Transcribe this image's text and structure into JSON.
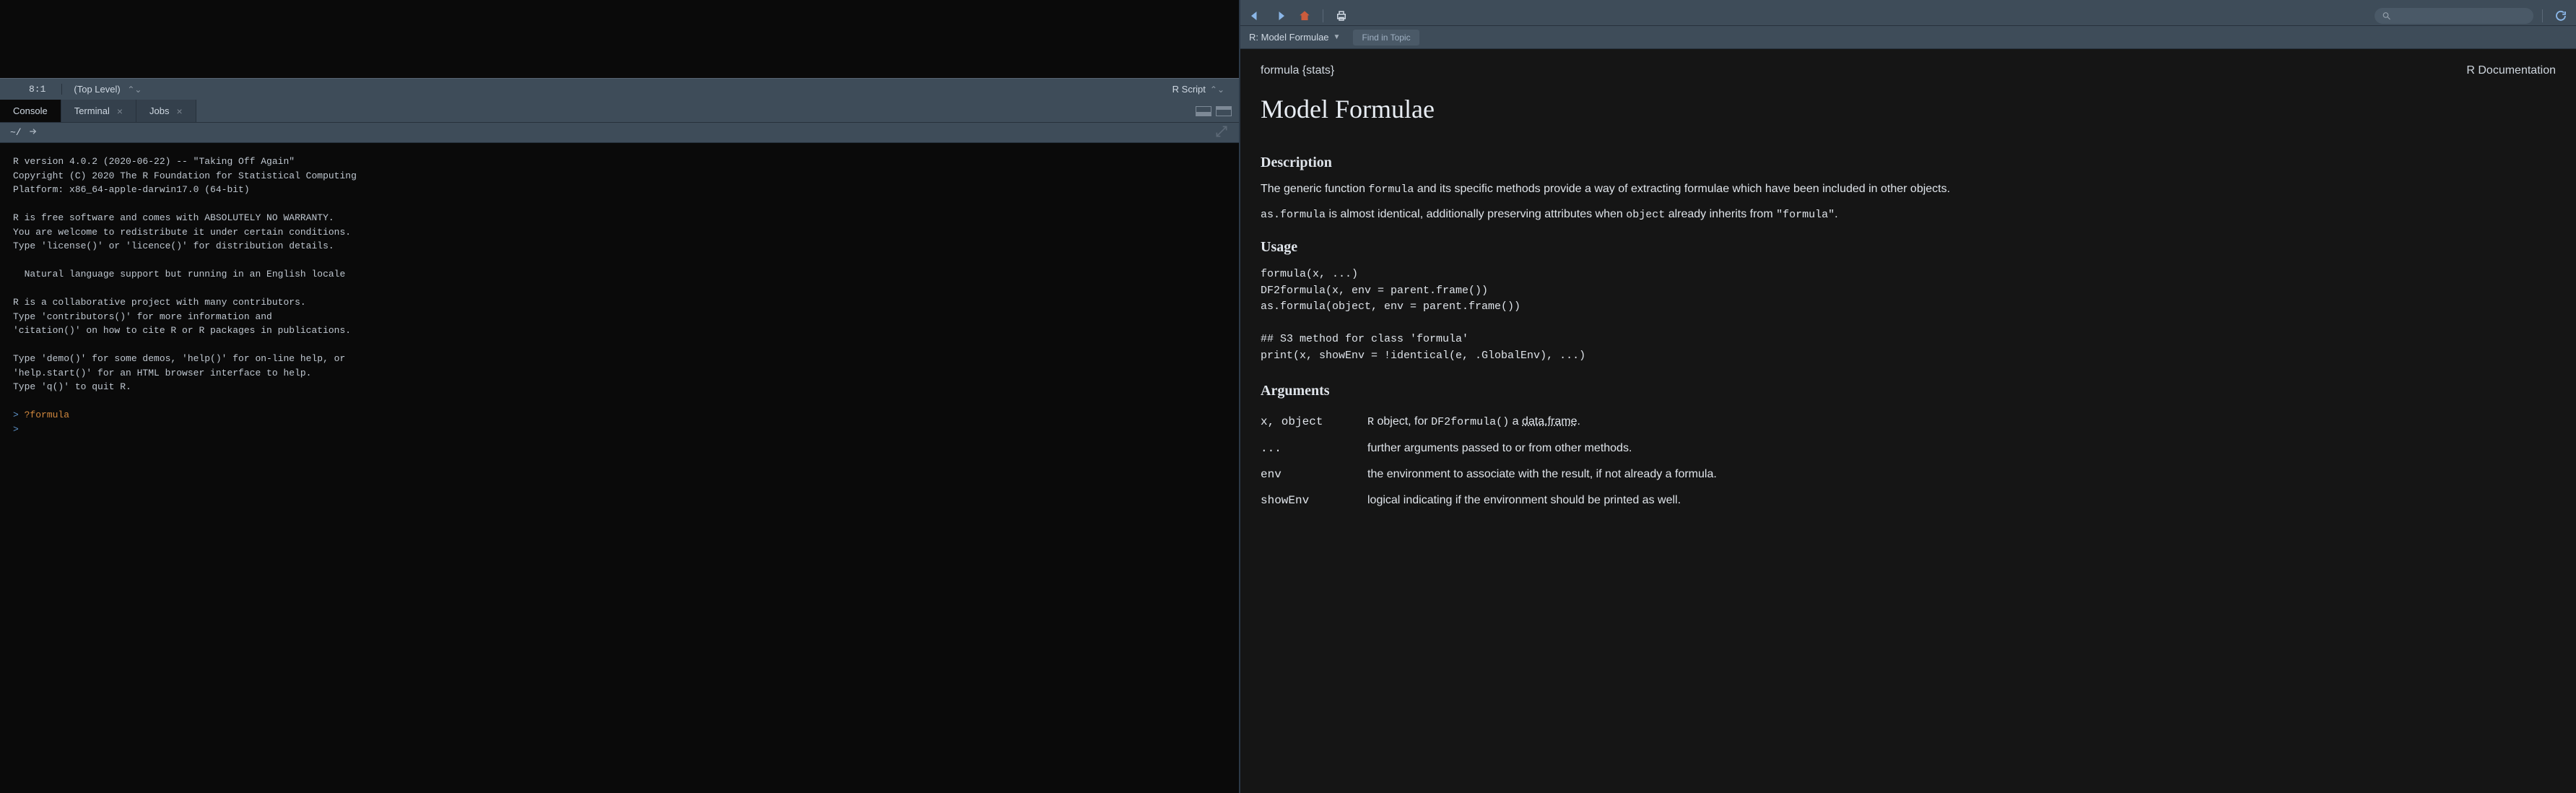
{
  "editor": {
    "cursor_pos": "8:1",
    "scope": "(Top Level)",
    "filetype": "R Script"
  },
  "console_tabs": [
    {
      "label": "Console",
      "closable": false,
      "selected": true
    },
    {
      "label": "Terminal",
      "closable": true,
      "selected": false
    },
    {
      "label": "Jobs",
      "closable": true,
      "selected": false
    }
  ],
  "console": {
    "wd": "~/",
    "startup": "R version 4.0.2 (2020-06-22) -- \"Taking Off Again\"\nCopyright (C) 2020 The R Foundation for Statistical Computing\nPlatform: x86_64-apple-darwin17.0 (64-bit)\n\nR is free software and comes with ABSOLUTELY NO WARRANTY.\nYou are welcome to redistribute it under certain conditions.\nType 'license()' or 'licence()' for distribution details.\n\n  Natural language support but running in an English locale\n\nR is a collaborative project with many contributors.\nType 'contributors()' for more information and\n'citation()' on how to cite R or R packages in publications.\n\nType 'demo()' for some demos, 'help()' for on-line help, or\n'help.start()' for an HTML browser interface to help.\nType 'q()' to quit R.\n",
    "prompt": ">",
    "command": "?formula"
  },
  "help": {
    "crumb": "R: Model Formulae",
    "find_placeholder": "Find in Topic",
    "doc": {
      "pkg": "formula {stats}",
      "kind": "R Documentation",
      "title": "Model Formulae",
      "h_description": "Description",
      "desc_a": "The generic function ",
      "desc_code_formula": "formula",
      "desc_b": " and its specific methods provide a way of extracting formulae which have been included in other objects.",
      "desc2_code_asformula": "as.formula",
      "desc2_a": " is almost identical, additionally preserving attributes when ",
      "desc2_code_object": "object",
      "desc2_b": " already inherits from ",
      "desc2_code_formula2": "\"formula\"",
      "desc2_c": ".",
      "h_usage": "Usage",
      "usage": "formula(x, ...)\nDF2formula(x, env = parent.frame())\nas.formula(object, env = parent.frame())\n\n## S3 method for class 'formula'\nprint(x, showEnv = !identical(e, .GlobalEnv), ...)",
      "h_arguments": "Arguments",
      "args": [
        {
          "name": "x, object",
          "desc_pre_code": "R",
          "desc_a": " object, for ",
          "code_a": "DF2formula()",
          "desc_b": " a ",
          "link": "data.frame",
          "desc_c": "."
        },
        {
          "name": "...",
          "desc": "further arguments passed to or from other methods."
        },
        {
          "name": "env",
          "desc": "the environment to associate with the result, if not already a formula."
        },
        {
          "name": "showEnv",
          "desc": "logical indicating if the environment should be printed as well."
        }
      ]
    }
  }
}
